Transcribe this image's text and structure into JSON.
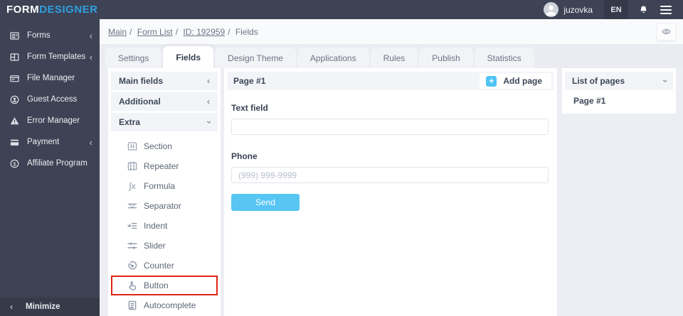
{
  "topbar": {
    "logo_part1": "FORM",
    "logo_part2": "DESIGNER",
    "username": "juzovka",
    "language": "EN"
  },
  "sidebar": {
    "items": [
      {
        "label": "Forms",
        "icon": "forms-icon",
        "expandable": true
      },
      {
        "label": "Form Templates",
        "icon": "form-templates-icon",
        "expandable": true
      },
      {
        "label": "File Manager",
        "icon": "file-manager-icon",
        "expandable": false
      },
      {
        "label": "Guest Access",
        "icon": "guest-access-icon",
        "expandable": false
      },
      {
        "label": "Error Manager",
        "icon": "error-manager-icon",
        "expandable": false
      },
      {
        "label": "Payment",
        "icon": "payment-icon",
        "expandable": true
      },
      {
        "label": "Affiliate Program",
        "icon": "affiliate-program-icon",
        "expandable": false
      }
    ],
    "collapse_chevron": "‹",
    "minimize_label": "Minimize"
  },
  "breadcrumb": {
    "separator": "/",
    "items": [
      {
        "label": "Main",
        "link": true
      },
      {
        "label": "Form List",
        "link": true
      },
      {
        "label": "ID: 192959",
        "link": true
      },
      {
        "label": "Fields",
        "link": false
      }
    ]
  },
  "tabs": [
    {
      "label": "Settings",
      "active": false
    },
    {
      "label": "Fields",
      "active": true
    },
    {
      "label": "Design Theme",
      "active": false
    },
    {
      "label": "Applications",
      "active": false
    },
    {
      "label": "Rules",
      "active": false
    },
    {
      "label": "Publish",
      "active": false
    },
    {
      "label": "Statistics",
      "active": false
    }
  ],
  "fields_panel": {
    "sections": [
      {
        "label": "Main fields",
        "state": "collapsed"
      },
      {
        "label": "Additional",
        "state": "collapsed"
      },
      {
        "label": "Extra",
        "state": "expanded"
      }
    ],
    "extra_items": [
      {
        "label": "Section",
        "icon": "section-icon",
        "highlighted": false
      },
      {
        "label": "Repeater",
        "icon": "repeater-icon",
        "highlighted": false
      },
      {
        "label": "Formula",
        "icon": "formula-icon",
        "icon_glyph": "∫x",
        "highlighted": false
      },
      {
        "label": "Separator",
        "icon": "separator-icon",
        "highlighted": false
      },
      {
        "label": "Indent",
        "icon": "indent-icon",
        "highlighted": false
      },
      {
        "label": "Slider",
        "icon": "slider-icon",
        "highlighted": false
      },
      {
        "label": "Counter",
        "icon": "counter-icon",
        "highlighted": false
      },
      {
        "label": "Button",
        "icon": "button-icon",
        "highlighted": true
      },
      {
        "label": "Autocomplete",
        "icon": "autocomplete-icon",
        "highlighted": false
      }
    ]
  },
  "page_editor": {
    "page_title": "Page #1",
    "add_page_label": "Add page",
    "add_page_plus": "+",
    "fields": [
      {
        "label": "Text field",
        "value": "",
        "placeholder": ""
      },
      {
        "label": "Phone",
        "value": "",
        "placeholder": "(999) 999-9999"
      }
    ],
    "send_label": "Send"
  },
  "pages_panel": {
    "title": "List of pages",
    "pages": [
      "Page #1"
    ]
  },
  "colors": {
    "topbar_bg": "#3d4354",
    "logo_accent": "#2e9fe0",
    "accent_blue": "#4fc4f5",
    "send_button": "#57c6f3",
    "highlight_red": "#e02417",
    "page_bg": "#eceef3"
  }
}
